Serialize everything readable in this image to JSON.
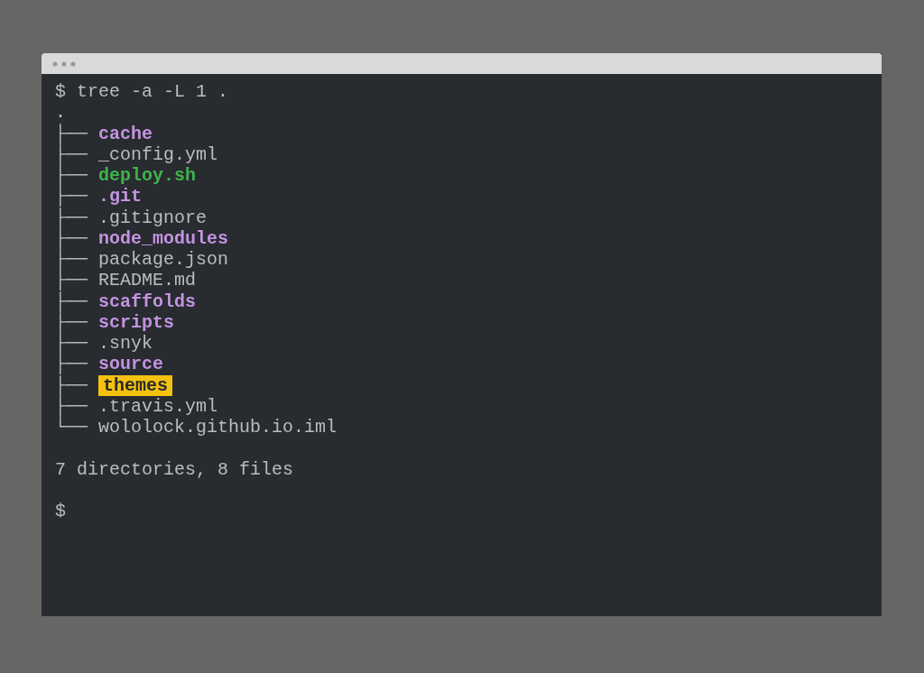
{
  "terminal": {
    "command": "$ tree -a -L 1 .",
    "root": ".",
    "entries": [
      {
        "prefix": "├──",
        "name": "cache",
        "kind": "dir"
      },
      {
        "prefix": "├──",
        "name": "_config.yml",
        "kind": "file"
      },
      {
        "prefix": "├──",
        "name": "deploy.sh",
        "kind": "exec"
      },
      {
        "prefix": "├──",
        "name": ".git",
        "kind": "dir"
      },
      {
        "prefix": "├──",
        "name": ".gitignore",
        "kind": "file"
      },
      {
        "prefix": "├──",
        "name": "node_modules",
        "kind": "dir"
      },
      {
        "prefix": "├──",
        "name": "package.json",
        "kind": "file"
      },
      {
        "prefix": "├──",
        "name": "README.md",
        "kind": "file"
      },
      {
        "prefix": "├──",
        "name": "scaffolds",
        "kind": "dir"
      },
      {
        "prefix": "├──",
        "name": "scripts",
        "kind": "dir"
      },
      {
        "prefix": "├──",
        "name": ".snyk",
        "kind": "file"
      },
      {
        "prefix": "├──",
        "name": "source",
        "kind": "dir"
      },
      {
        "prefix": "├──",
        "name": "themes",
        "kind": "sticky"
      },
      {
        "prefix": "├──",
        "name": ".travis.yml",
        "kind": "file"
      },
      {
        "prefix": "└──",
        "name": "wololock.github.io.iml",
        "kind": "file"
      }
    ],
    "summary": "7 directories, 8 files",
    "prompt": "$"
  }
}
